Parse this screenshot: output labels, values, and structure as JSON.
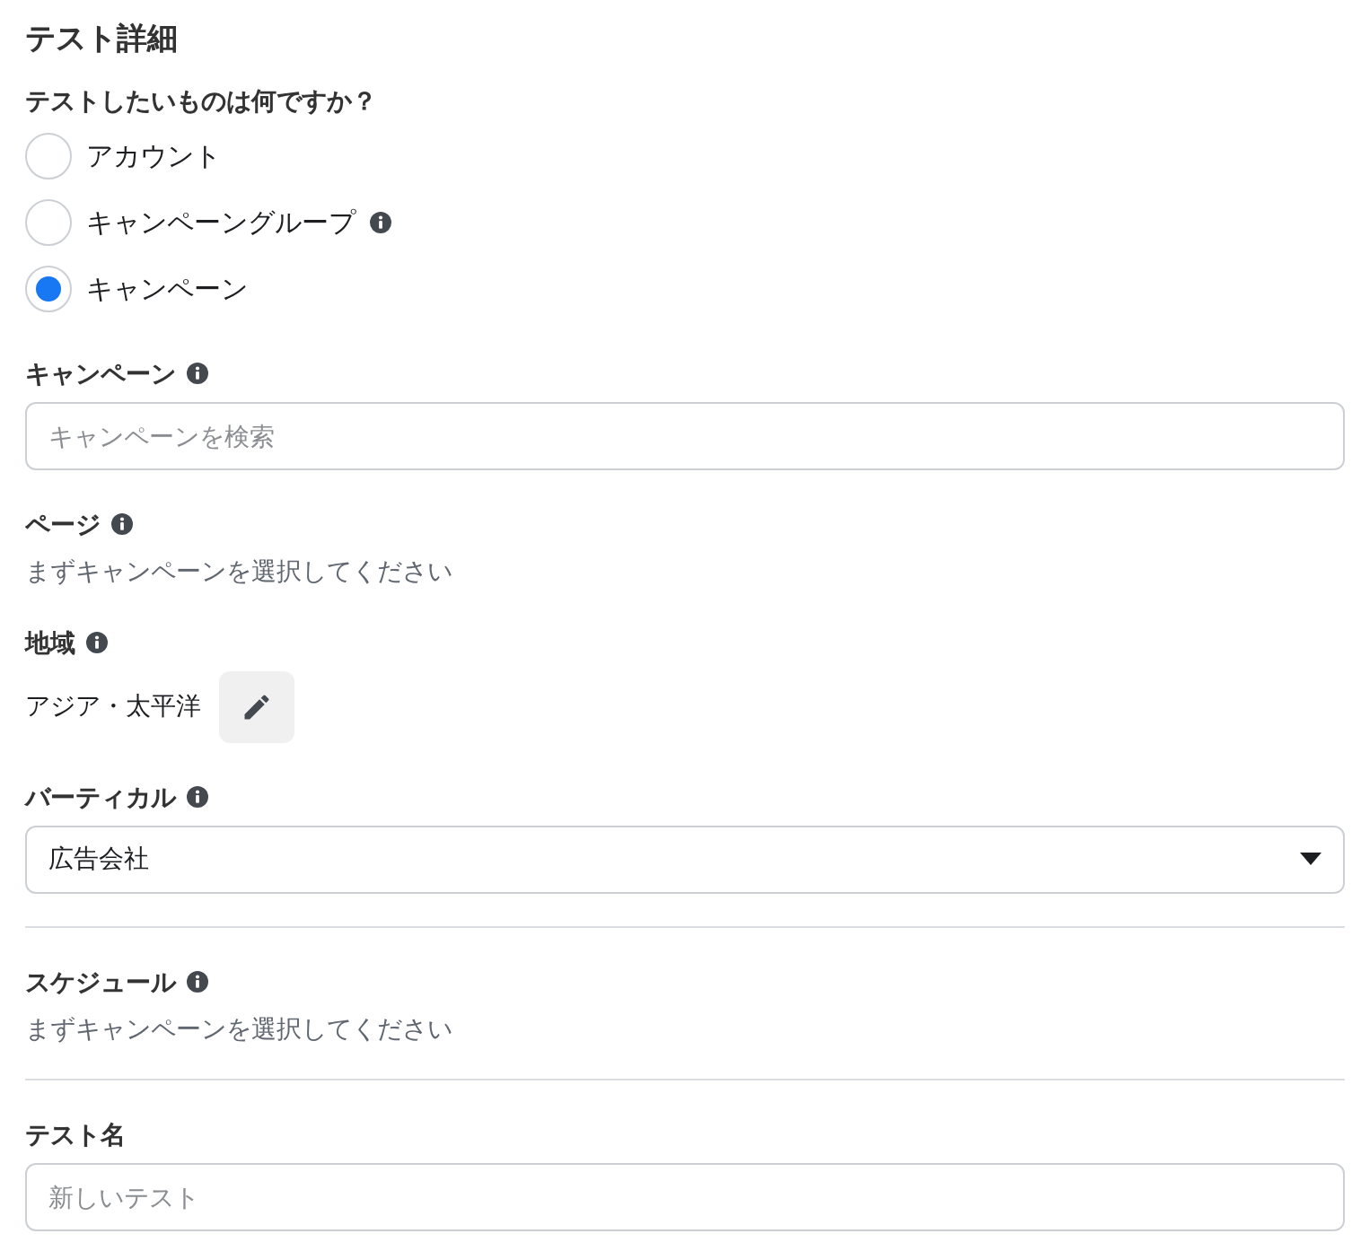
{
  "title": "テスト詳細",
  "question": {
    "label": "テストしたいものは何ですか？",
    "options": [
      {
        "label": "アカウント",
        "info": false,
        "selected": false
      },
      {
        "label": "キャンペーングループ",
        "info": true,
        "selected": false
      },
      {
        "label": "キャンペーン",
        "info": false,
        "selected": true
      }
    ]
  },
  "sections": [
    {
      "kind": "search",
      "label": "キャンペーン",
      "info": true,
      "placeholder": "キャンペーンを検索"
    },
    {
      "kind": "note",
      "label": "ページ",
      "info": true,
      "text": "まずキャンペーンを選択してください"
    },
    {
      "kind": "value_edit",
      "label": "地域",
      "info": true,
      "value": "アジア・太平洋"
    },
    {
      "kind": "select",
      "label": "バーティカル",
      "info": true,
      "value": "広告会社"
    },
    {
      "kind": "divider"
    },
    {
      "kind": "note",
      "label": "スケジュール",
      "info": true,
      "text": "まずキャンペーンを選択してください"
    },
    {
      "kind": "divider"
    },
    {
      "kind": "field",
      "label": "テスト名",
      "info": false,
      "placeholder": "新しいテスト"
    }
  ]
}
